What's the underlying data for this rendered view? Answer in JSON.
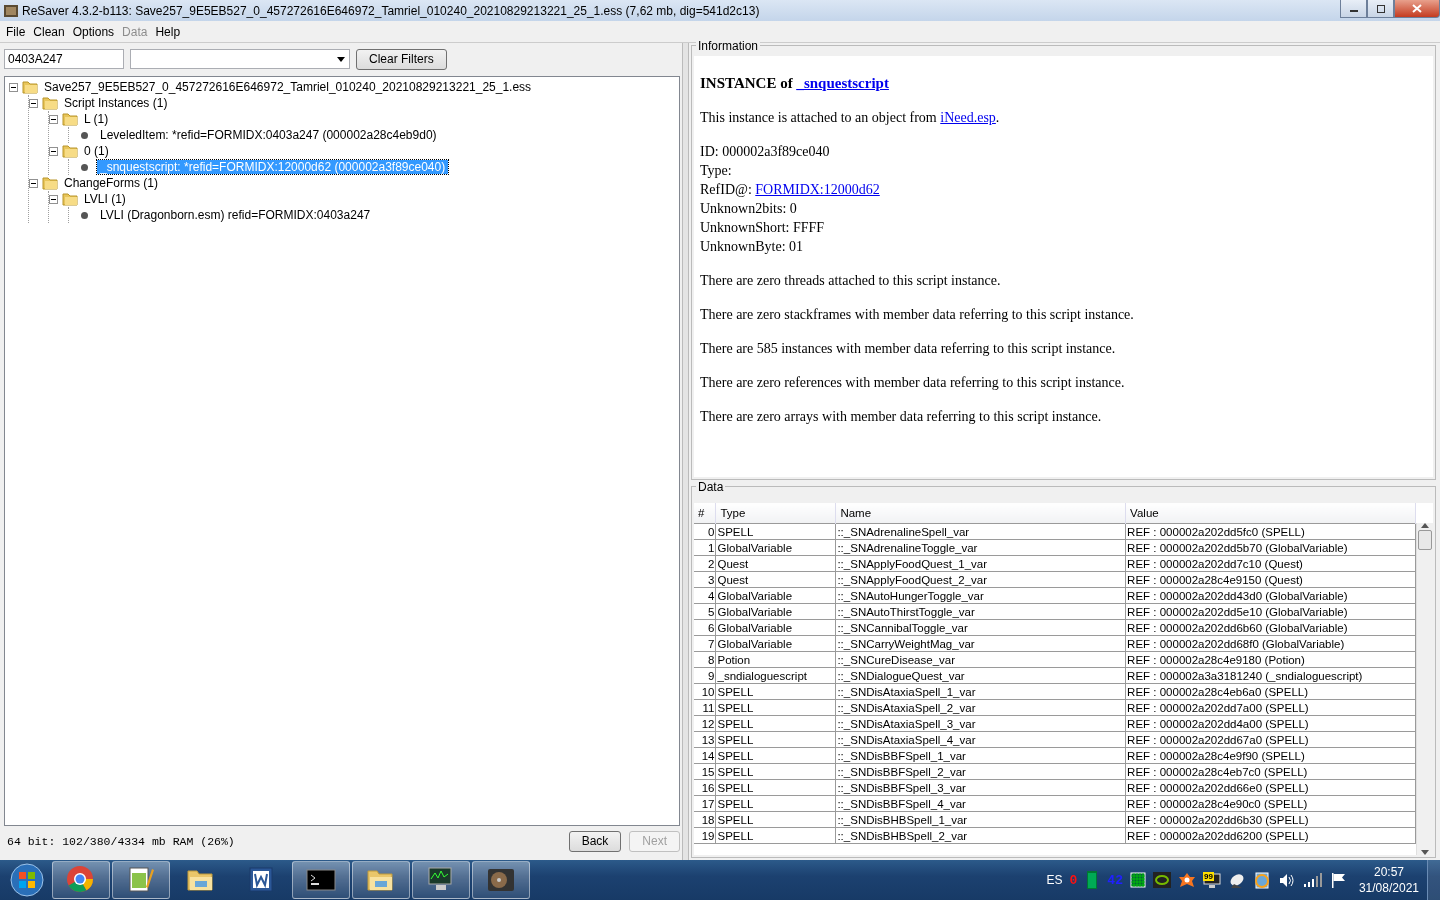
{
  "window": {
    "title": "ReSaver 4.3.2-b113: Save257_9E5EB527_0_457272616E646972_Tamriel_010240_20210829213221_25_1.ess (7,62 mb, dig=541d2c13)"
  },
  "menu": [
    {
      "label": "File",
      "disabled": false
    },
    {
      "label": "Clean",
      "disabled": false
    },
    {
      "label": "Options",
      "disabled": false
    },
    {
      "label": "Data",
      "disabled": true
    },
    {
      "label": "Help",
      "disabled": false
    }
  ],
  "filter": {
    "value": "0403A247",
    "clear_button": "Clear Filters"
  },
  "tree": [
    {
      "kind": "folder",
      "label": "Save257_9E5EB527_0_457272616E646972_Tamriel_010240_20210829213221_25_1.ess",
      "expanded": true,
      "selected": false,
      "children": [
        {
          "kind": "folder",
          "label": "Script Instances (1)",
          "expanded": true,
          "selected": false,
          "children": [
            {
              "kind": "folder",
              "label": "L (1)",
              "expanded": true,
              "selected": false,
              "children": [
                {
                  "kind": "leaf",
                  "label": "LeveledItem: *refid=FORMIDX:0403a247 (000002a28c4eb9d0)",
                  "selected": false
                }
              ]
            },
            {
              "kind": "folder",
              "label": "0 (1)",
              "expanded": true,
              "selected": false,
              "children": [
                {
                  "kind": "leaf",
                  "label": "_snquestscript: *refid=FORMIDX:12000d62 (000002a3f89ce040)",
                  "selected": true
                }
              ]
            }
          ]
        },
        {
          "kind": "folder",
          "label": "ChangeForms (1)",
          "expanded": true,
          "selected": false,
          "children": [
            {
              "kind": "folder",
              "label": "LVLI (1)",
              "expanded": true,
              "selected": false,
              "children": [
                {
                  "kind": "leaf",
                  "label": "LVLI (Dragonborn.esm) refid=FORMIDX:0403a247",
                  "selected": false
                }
              ]
            }
          ]
        }
      ]
    }
  ],
  "status": "64 bit: 102/380/4334 mb RAM (26%)",
  "nav": [
    {
      "label": "Back",
      "disabled": false
    },
    {
      "label": "Next",
      "disabled": true
    }
  ],
  "information": {
    "title": "Information",
    "blocks": [
      {
        "kind": "heading",
        "parts": [
          {
            "text": "INSTANCE of "
          },
          {
            "link": "_snquestscript"
          }
        ]
      },
      {
        "kind": "paragraph",
        "parts": [
          {
            "text": "This instance is attached to an object from "
          },
          {
            "link": "iNeed.esp"
          },
          {
            "text": "."
          }
        ]
      },
      {
        "kind": "paragraph",
        "parts": [
          {
            "text": "ID: 000002a3f89ce040"
          }
        ]
      },
      {
        "kind": "line",
        "parts": [
          {
            "text": "Type:"
          }
        ]
      },
      {
        "kind": "line",
        "parts": [
          {
            "text": "RefID@: "
          },
          {
            "link": "FORMIDX:12000d62"
          }
        ]
      },
      {
        "kind": "line",
        "parts": [
          {
            "text": "Unknown2bits: 0"
          }
        ]
      },
      {
        "kind": "line",
        "parts": [
          {
            "text": "UnknownShort: FFFF"
          }
        ]
      },
      {
        "kind": "line",
        "parts": [
          {
            "text": "UnknownByte: 01"
          }
        ]
      },
      {
        "kind": "paragraph",
        "parts": [
          {
            "text": "There are zero threads attached to this script instance."
          }
        ]
      },
      {
        "kind": "paragraph",
        "parts": [
          {
            "text": "There are zero stackframes with member data referring to this script instance."
          }
        ]
      },
      {
        "kind": "paragraph",
        "parts": [
          {
            "text": "There are 585 instances with member data referring to this script instance."
          }
        ]
      },
      {
        "kind": "paragraph",
        "parts": [
          {
            "text": "There are zero references with member data referring to this script instance."
          }
        ]
      },
      {
        "kind": "paragraph",
        "parts": [
          {
            "text": "There are zero arrays with member data referring to this script instance."
          }
        ]
      }
    ]
  },
  "data": {
    "title": "Data",
    "columns": [
      "#",
      "Type",
      "Name",
      "Value"
    ],
    "rows": [
      [
        "0",
        "SPELL",
        "::_SNAdrenalineSpell_var",
        "REF : 000002a202dd5fc0 (SPELL)"
      ],
      [
        "1",
        "GlobalVariable",
        "::_SNAdrenalineToggle_var",
        "REF : 000002a202dd5b70 (GlobalVariable)"
      ],
      [
        "2",
        "Quest",
        "::_SNApplyFoodQuest_1_var",
        "REF : 000002a202dd7c10 (Quest)"
      ],
      [
        "3",
        "Quest",
        "::_SNApplyFoodQuest_2_var",
        "REF : 000002a28c4e9150 (Quest)"
      ],
      [
        "4",
        "GlobalVariable",
        "::_SNAutoHungerToggle_var",
        "REF : 000002a202dd43d0 (GlobalVariable)"
      ],
      [
        "5",
        "GlobalVariable",
        "::_SNAutoThirstToggle_var",
        "REF : 000002a202dd5e10 (GlobalVariable)"
      ],
      [
        "6",
        "GlobalVariable",
        "::_SNCannibalToggle_var",
        "REF : 000002a202dd6b60 (GlobalVariable)"
      ],
      [
        "7",
        "GlobalVariable",
        "::_SNCarryWeightMag_var",
        "REF : 000002a202dd68f0 (GlobalVariable)"
      ],
      [
        "8",
        "Potion",
        "::_SNCureDisease_var",
        "REF : 000002a28c4e9180 (Potion)"
      ],
      [
        "9",
        "_sndialoguescript",
        "::_SNDialogueQuest_var",
        "REF : 000002a3a3181240 (_sndialoguescript)"
      ],
      [
        "10",
        "SPELL",
        "::_SNDisAtaxiaSpell_1_var",
        "REF : 000002a28c4eb6a0 (SPELL)"
      ],
      [
        "11",
        "SPELL",
        "::_SNDisAtaxiaSpell_2_var",
        "REF : 000002a202dd7a00 (SPELL)"
      ],
      [
        "12",
        "SPELL",
        "::_SNDisAtaxiaSpell_3_var",
        "REF : 000002a202dd4a00 (SPELL)"
      ],
      [
        "13",
        "SPELL",
        "::_SNDisAtaxiaSpell_4_var",
        "REF : 000002a202dd67a0 (SPELL)"
      ],
      [
        "14",
        "SPELL",
        "::_SNDisBBFSpell_1_var",
        "REF : 000002a28c4e9f90 (SPELL)"
      ],
      [
        "15",
        "SPELL",
        "::_SNDisBBFSpell_2_var",
        "REF : 000002a28c4eb7c0 (SPELL)"
      ],
      [
        "16",
        "SPELL",
        "::_SNDisBBFSpell_3_var",
        "REF : 000002a202dd66e0 (SPELL)"
      ],
      [
        "17",
        "SPELL",
        "::_SNDisBBFSpell_4_var",
        "REF : 000002a28c4e90c0 (SPELL)"
      ],
      [
        "18",
        "SPELL",
        "::_SNDisBHBSpell_1_var",
        "REF : 000002a202dd6b30 (SPELL)"
      ],
      [
        "19",
        "SPELL",
        "::_SNDisBHBSpell_2_var",
        "REF : 000002a202dd6200 (SPELL)"
      ]
    ]
  },
  "taskbar": {
    "apps": [
      {
        "kind": "chrome",
        "open": true
      },
      {
        "kind": "notepad",
        "open": true
      },
      {
        "kind": "folder",
        "open": false
      },
      {
        "kind": "word",
        "open": false
      },
      {
        "kind": "terminal",
        "open": true
      },
      {
        "kind": "folder",
        "open": true
      },
      {
        "kind": "monitor",
        "open": true
      },
      {
        "kind": "disk",
        "open": true
      }
    ],
    "tray": [
      {
        "kind": "text",
        "text": "ES"
      },
      {
        "kind": "counter",
        "text": "0",
        "color": "#ff1010"
      },
      {
        "kind": "battery"
      },
      {
        "kind": "counter",
        "text": "42",
        "color": "#2020ff"
      },
      {
        "kind": "grid"
      },
      {
        "kind": "gpu"
      },
      {
        "kind": "antivirus"
      },
      {
        "kind": "screen",
        "text": "99"
      },
      {
        "kind": "dish"
      },
      {
        "kind": "update"
      },
      {
        "kind": "volume"
      },
      {
        "kind": "signal"
      },
      {
        "kind": "flag"
      }
    ],
    "time": "20:57",
    "date": "31/08/2021"
  }
}
